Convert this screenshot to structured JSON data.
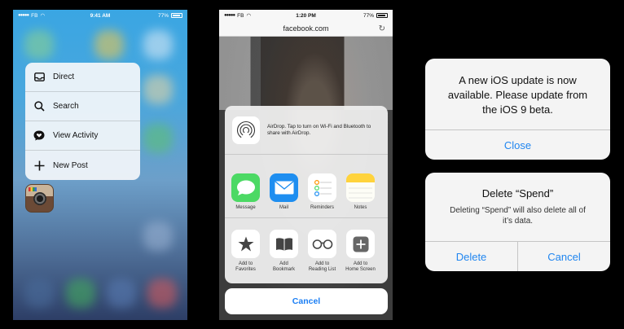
{
  "home_screen": {
    "status_bar": {
      "carrier": "FB",
      "time": "9:41 AM",
      "battery": "77%"
    },
    "quick_actions": [
      {
        "label": "Direct",
        "icon": "inbox-tray-icon"
      },
      {
        "label": "Search",
        "icon": "magnifier-icon"
      },
      {
        "label": "View Activity",
        "icon": "heart-bubble-icon"
      },
      {
        "label": "New Post",
        "icon": "plus-icon"
      }
    ],
    "app_icon": "instagram-app-icon"
  },
  "share_sheet": {
    "status_bar": {
      "carrier": "FB",
      "time": "1:20 PM",
      "battery": "77%"
    },
    "url": "facebook.com",
    "airdrop_text": "AirDrop. Tap to turn on Wi-Fi and Bluetooth to share with AirDrop.",
    "share_apps": [
      {
        "label": "Message",
        "color": "#4cd964"
      },
      {
        "label": "Mail",
        "color": "#1e8ef0"
      },
      {
        "label": "Reminders",
        "color": "#ffffff"
      },
      {
        "label": "Notes",
        "color": "#ffd33c"
      }
    ],
    "actions": [
      {
        "label_1": "Add to",
        "label_2": "Favorites",
        "icon": "star-icon"
      },
      {
        "label_1": "Add",
        "label_2": "Bookmark",
        "icon": "book-icon"
      },
      {
        "label_1": "Add to",
        "label_2": "Reading List",
        "icon": "glasses-icon"
      },
      {
        "label_1": "Add to",
        "label_2": "Home Screen",
        "icon": "plus-square-icon"
      }
    ],
    "cancel": "Cancel"
  },
  "alerts": {
    "update": {
      "line1": "A new iOS update is now",
      "line2": "available. Please update from",
      "line3": "the iOS 9 beta.",
      "button": "Close"
    },
    "delete": {
      "title": "Delete “Spend”",
      "line1": "Deleting “Spend” will also delete all of",
      "line2": "it’s data.",
      "delete_button": "Delete",
      "cancel_button": "Cancel"
    }
  }
}
